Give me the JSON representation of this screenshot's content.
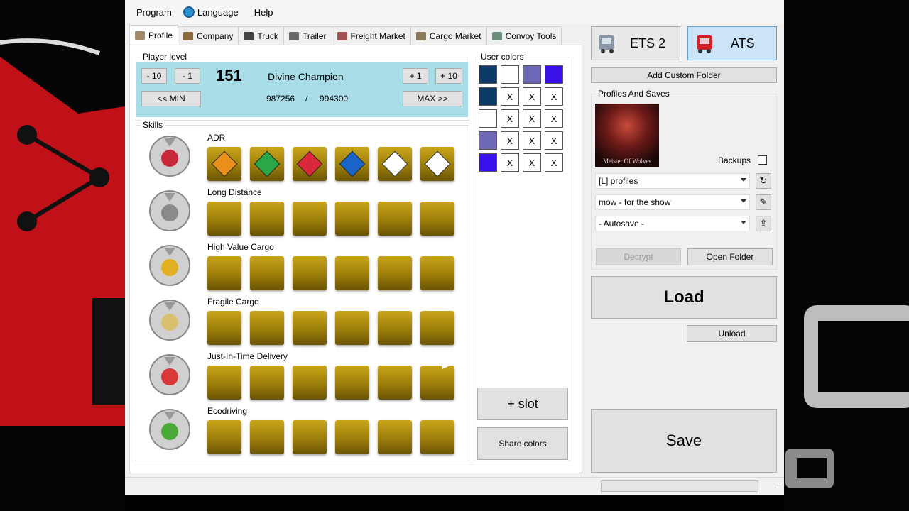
{
  "menu": {
    "program": "Program",
    "language": "Language",
    "help": "Help"
  },
  "tabs": [
    {
      "label": "Profile",
      "icon": "profile-icon"
    },
    {
      "label": "Company",
      "icon": "company-icon"
    },
    {
      "label": "Truck",
      "icon": "truck-icon"
    },
    {
      "label": "Trailer",
      "icon": "trailer-icon"
    },
    {
      "label": "Freight Market",
      "icon": "freight-icon"
    },
    {
      "label": "Cargo Market",
      "icon": "cargo-icon"
    },
    {
      "label": "Convoy Tools",
      "icon": "convoy-icon"
    }
  ],
  "player_level": {
    "title": "Player level",
    "minus10": "- 10",
    "minus1": "- 1",
    "plus1": "+ 1",
    "plus10": "+ 10",
    "level": "151",
    "rank": "Divine Champion",
    "xp_current": "987256",
    "xp_sep": "/",
    "xp_next": "994300",
    "min_label": "<< MIN",
    "max_label": "MAX >>"
  },
  "skills": {
    "title": "Skills",
    "rows": [
      {
        "label": "ADR",
        "icon": "adr-skill-icon"
      },
      {
        "label": "Long Distance",
        "icon": "long-distance-skill-icon"
      },
      {
        "label": "High Value Cargo",
        "icon": "high-value-cargo-skill-icon"
      },
      {
        "label": "Fragile Cargo",
        "icon": "fragile-cargo-skill-icon"
      },
      {
        "label": "Just-In-Time Delivery",
        "icon": "just-in-time-skill-icon"
      },
      {
        "label": "Ecodriving",
        "icon": "ecodriving-skill-icon"
      }
    ],
    "adr_classes": [
      {
        "name": "explosives-icon",
        "color": "#e8901a"
      },
      {
        "name": "gases-icon",
        "color": "#2aa84a"
      },
      {
        "name": "flammable-liquids-icon",
        "color": "#d8283a"
      },
      {
        "name": "flammable-solids-icon",
        "color": "#1a64c8"
      },
      {
        "name": "toxic-icon",
        "color": "#ffffff"
      },
      {
        "name": "corrosive-icon",
        "color": "#ffffff"
      }
    ]
  },
  "user_colors": {
    "title": "User colors",
    "palette": [
      "#0e3a6a",
      "#ffffff",
      "#6e68b8",
      "#3a10e8"
    ],
    "rows": [
      "#0e3a6a",
      "#ffffff",
      "#6e68b8",
      "#3a10e8"
    ],
    "x_label": "X",
    "add_slot": "+ slot",
    "share": "Share colors"
  },
  "game": {
    "ets2": "ETS 2",
    "ats": "ATS"
  },
  "add_custom_folder": "Add Custom Folder",
  "profiles": {
    "title": "Profiles And Saves",
    "avatar_caption": "Meister Of Wolves",
    "backups": "Backups",
    "profiles_combo": "[L] profiles",
    "profile_combo": "mow - for the show",
    "save_combo": "- Autosave -",
    "decrypt": "Decrypt",
    "open_folder": "Open Folder"
  },
  "load": "Load",
  "unload": "Unload",
  "save": "Save"
}
